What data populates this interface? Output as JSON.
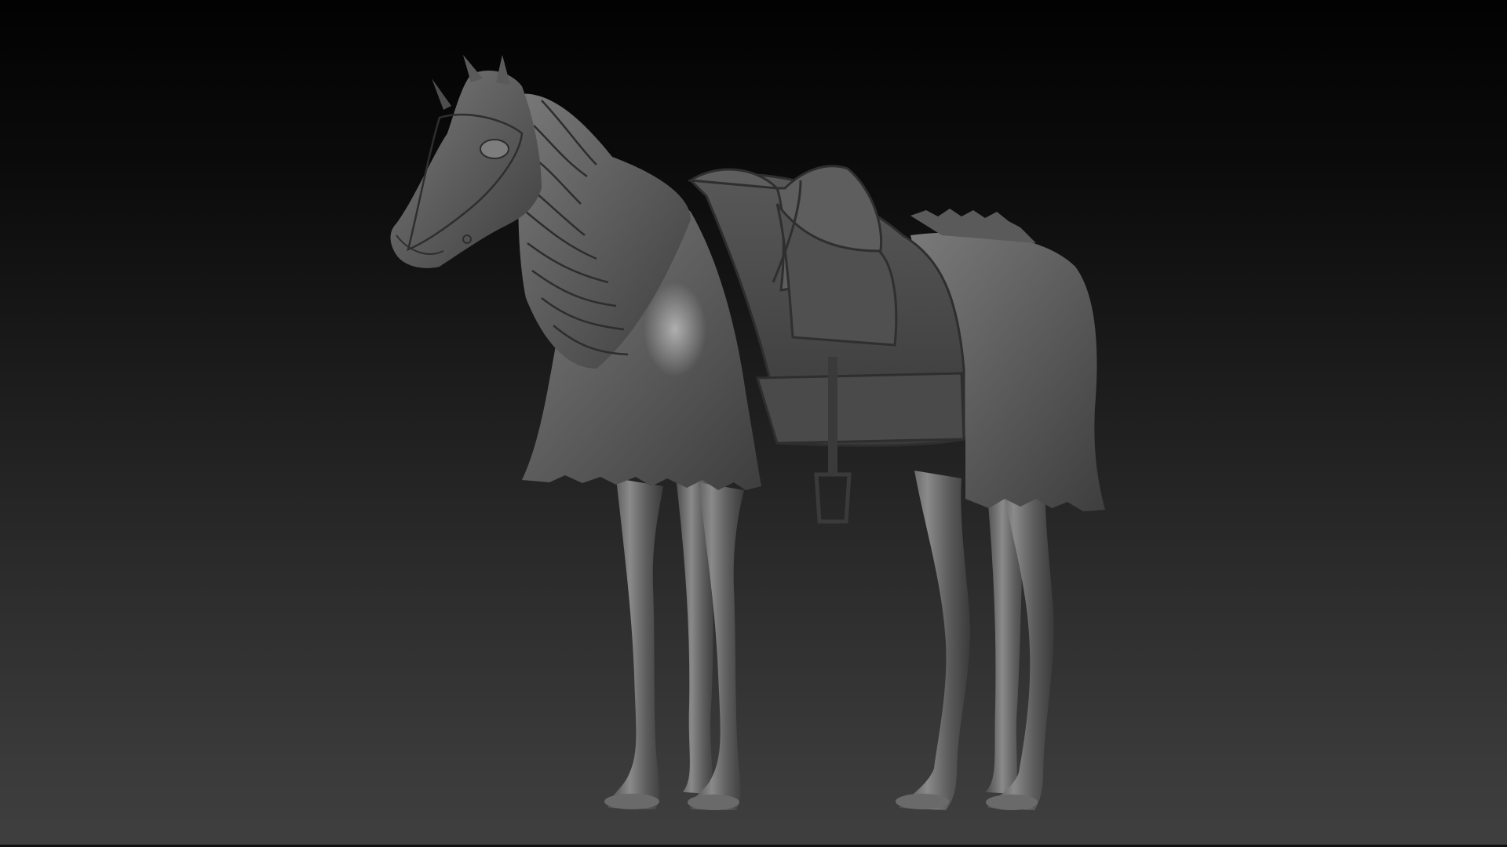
{
  "scene": {
    "subject": "armored-horse-sculpt",
    "colors": {
      "background_top": "#020202",
      "background_bottom": "#3f3f3f",
      "clay_base": "#5e5e5e",
      "clay_shadow": "#2b2b2b",
      "clay_highlight": "#a5a5a5"
    }
  }
}
